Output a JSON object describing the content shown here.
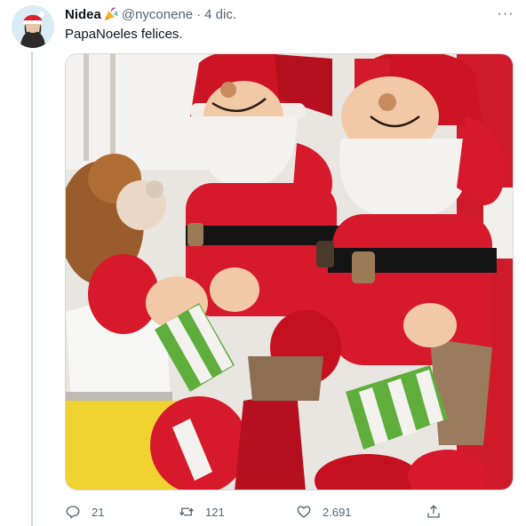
{
  "tweet": {
    "author_name": "Nidea",
    "author_badge_icon": "party-popper-icon",
    "handle": "@nyconene",
    "separator": "·",
    "date": "4 dic.",
    "more_label": "···",
    "text": "PapaNoeles felices.",
    "media_subject": "photo-two-santa-claus-plush-dolls",
    "stats": {
      "replies": "21",
      "retweets": "121",
      "likes": "2.691"
    }
  },
  "colors": {
    "text_primary": "#0f1419",
    "text_secondary": "#536471",
    "border": "#cfd9de",
    "santa_red": "#d7192c",
    "beard_white": "#f4f2ef",
    "stripe_green": "#5fae3c"
  }
}
